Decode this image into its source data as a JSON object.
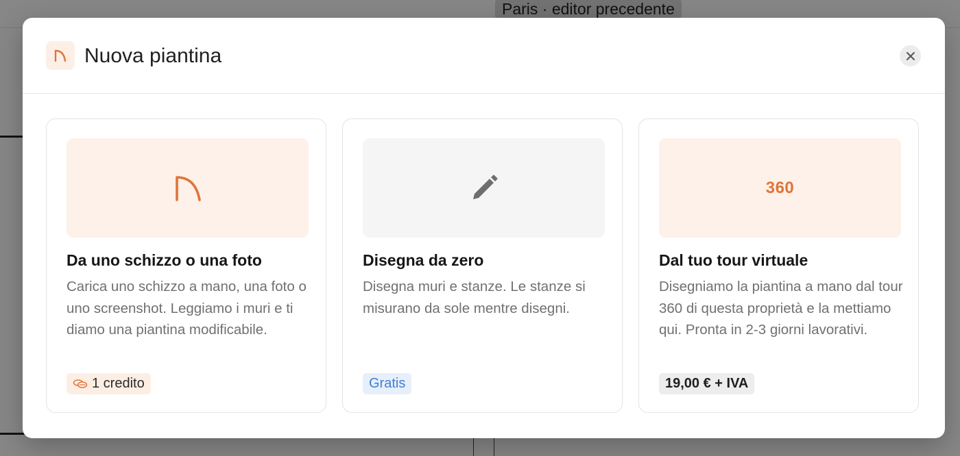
{
  "background": {
    "breadcrumb": "Paris · editor precedente"
  },
  "modal": {
    "title": "Nuova piantina",
    "header_icon": "arc-logo-icon",
    "close_icon": "close-icon"
  },
  "options": [
    {
      "id": "sketch",
      "title": "Da uno schizzo o una foto",
      "description": "Carica uno schizzo a mano, una foto o uno screenshot. Leggiamo i muri e ti diamo una piantina modificabile.",
      "thumbnail_icon": "arc-logo-icon",
      "badge_icon": "coins-icon",
      "badge": "1 credito"
    },
    {
      "id": "draw",
      "title": "Disegna da zero",
      "description": "Disegna muri e stanze. Le stanze si misurano da sole mentre disegni.",
      "thumbnail_icon": "pencil-icon",
      "badge": "Gratis"
    },
    {
      "id": "tour",
      "title": "Dal tuo tour virtuale",
      "description": "Disegniamo la piantina a mano dal tour 360 di questa proprietà e la mettiamo qui. Pronta in 2-3 giorni lavorativi.",
      "thumbnail_text": "360",
      "badge": "19,00 € + IVA"
    }
  ],
  "colors": {
    "accent": "#e0743a",
    "accent_bg": "#fdf1e9",
    "free_badge_text": "#3f7fd1",
    "free_badge_bg": "#e7effb"
  }
}
